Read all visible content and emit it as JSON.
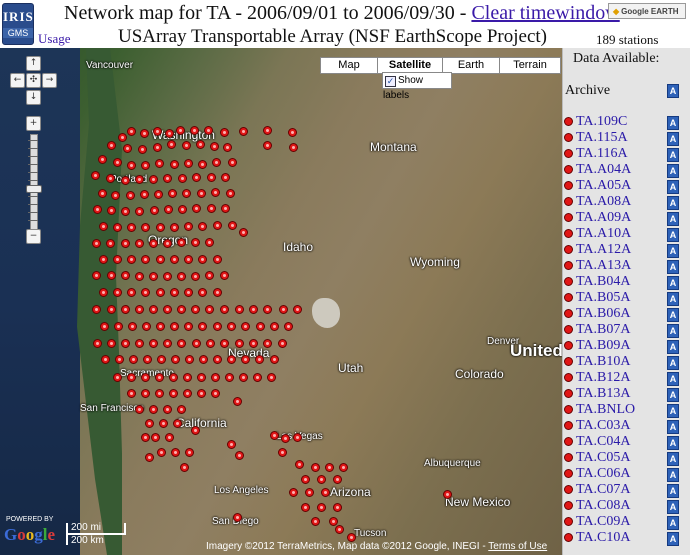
{
  "header": {
    "logo_top": "IRIS",
    "logo_bottom": "GMS",
    "title_prefix": "Network map for TA - 2006/09/01 to 2006/09/30 - ",
    "title_link": "Clear timewindow",
    "subtitle": "USArray Transportable Array (NSF EarthScope Project)",
    "usage_link": "Usage",
    "station_count": "189 stations",
    "google_earth_button": "Google EARTH"
  },
  "map": {
    "type_buttons": [
      "Map",
      "Satellite",
      "Earth",
      "Terrain"
    ],
    "selected_type": "Satellite",
    "show_labels": "Show labels",
    "labels": {
      "vancouver": "Vancouver",
      "washington": "Washington",
      "portland": "Portland",
      "oregon": "Oregon",
      "montana": "Montana",
      "idaho": "Idaho",
      "wyoming": "Wyoming",
      "nevada": "Nevada",
      "utah": "Utah",
      "colorado": "Colorado",
      "denver": "Denver",
      "united": "United",
      "sacramento": "Sacramento",
      "san_francisco": "San Francisco",
      "california": "California",
      "las_vegas": "Las Vegas",
      "arizona": "Arizona",
      "albuquerque": "Albuquerque",
      "new_mexico": "New Mexico",
      "los_angeles": "Los Angeles",
      "san_diego": "San Diego",
      "tucson": "Tucson"
    },
    "scale_mi": "200 mi",
    "scale_km": "200 km",
    "google_logo": "Google",
    "powered_by": "POWERED BY",
    "imagery_text": "Imagery ©2012 TerraMetrics, Map data ©2012 Google, INEGI - ",
    "terms_link": "Terms of Use"
  },
  "sidebar": {
    "header": "Data Available:",
    "archive_label": "Archive",
    "badge": "A",
    "stations": [
      "TA.109C",
      "TA.115A",
      "TA.116A",
      "TA.A04A",
      "TA.A05A",
      "TA.A08A",
      "TA.A09A",
      "TA.A10A",
      "TA.A12A",
      "TA.A13A",
      "TA.B04A",
      "TA.B05A",
      "TA.B06A",
      "TA.B07A",
      "TA.B09A",
      "TA.B10A",
      "TA.B12A",
      "TA.B13A",
      "TA.BNLO",
      "TA.C03A",
      "TA.C04A",
      "TA.C05A",
      "TA.C06A",
      "TA.C07A",
      "TA.C08A",
      "TA.C09A",
      "TA.C10A"
    ]
  },
  "colors": {
    "station_marker": "#e01616",
    "link": "#3a1aa8",
    "badge": "#2e62b8"
  }
}
